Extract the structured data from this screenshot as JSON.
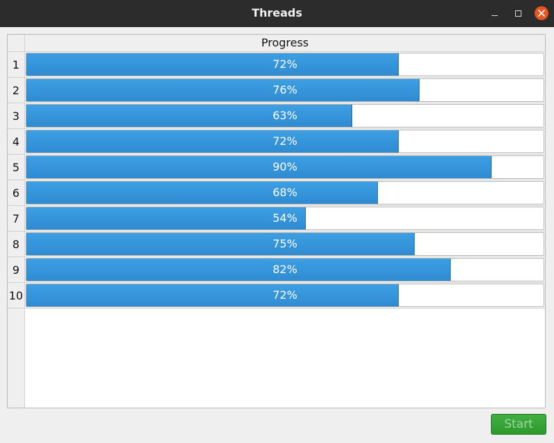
{
  "window": {
    "title": "Threads"
  },
  "table": {
    "column_header": "Progress",
    "rows": [
      {
        "label": "1",
        "value": 72,
        "text": "72%"
      },
      {
        "label": "2",
        "value": 76,
        "text": "76%"
      },
      {
        "label": "3",
        "value": 63,
        "text": "63%"
      },
      {
        "label": "4",
        "value": 72,
        "text": "72%"
      },
      {
        "label": "5",
        "value": 90,
        "text": "90%"
      },
      {
        "label": "6",
        "value": 68,
        "text": "68%"
      },
      {
        "label": "7",
        "value": 54,
        "text": "54%"
      },
      {
        "label": "8",
        "value": 75,
        "text": "75%"
      },
      {
        "label": "9",
        "value": 82,
        "text": "82%"
      },
      {
        "label": "10",
        "value": 72,
        "text": "72%"
      }
    ]
  },
  "footer": {
    "start_label": "Start"
  },
  "colors": {
    "bar_fill": "#3a97dc",
    "start_button": "#36a536",
    "close_button": "#e95420"
  }
}
